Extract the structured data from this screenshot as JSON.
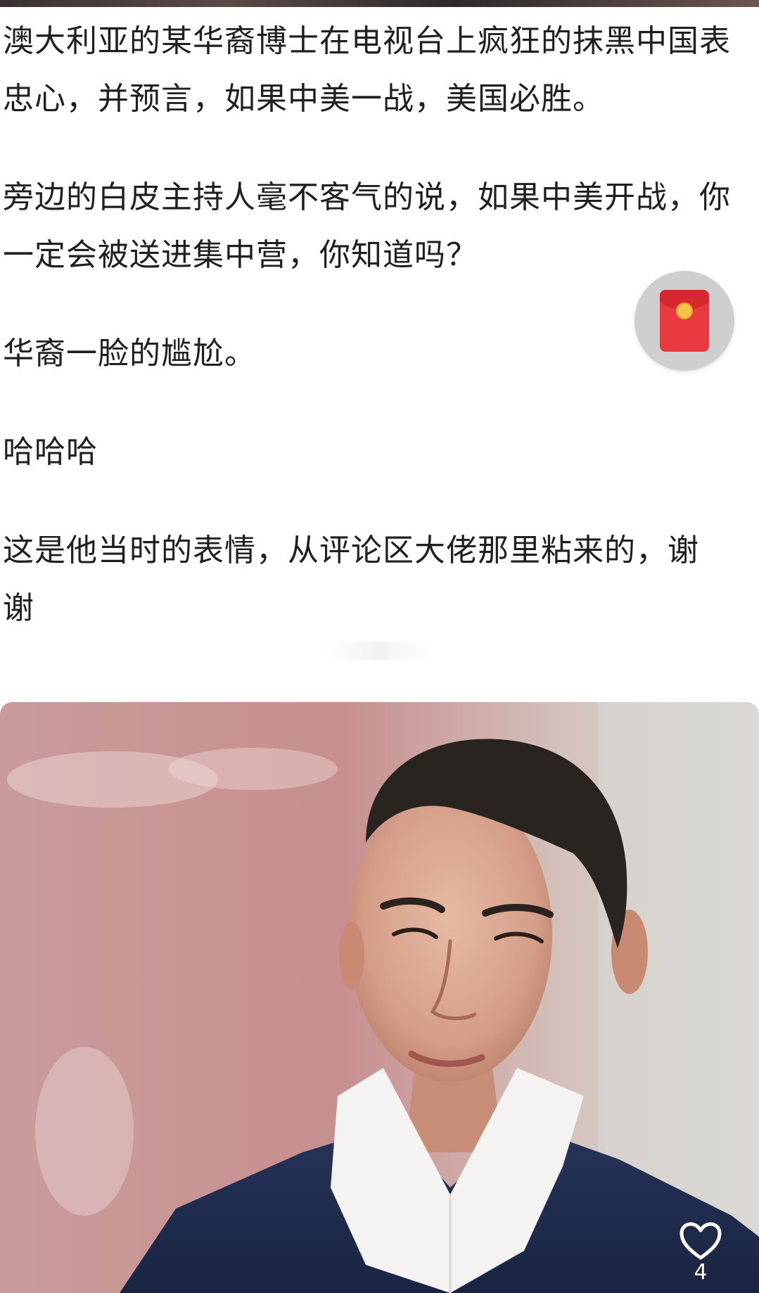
{
  "post": {
    "paragraphs": [
      "澳大利亚的某华裔博士在电视台上疯狂的抹黑中国表忠心，并预言，如果中美一战，美国必胜。",
      "旁边的白皮主持人毫不客气的说，如果中美开战，你一定会被送进集中营，你知道吗？",
      "华裔一脸的尴尬。",
      "哈哈哈",
      "这是他当时的表情，从评论区大佬那里粘来的，谢谢"
    ]
  },
  "floating_button": {
    "icon": "red-packet-icon",
    "color": "#e83a3f"
  },
  "photo": {
    "subject": "man-in-suit-photo"
  },
  "like": {
    "icon": "heart-outline-icon",
    "count": "4"
  }
}
